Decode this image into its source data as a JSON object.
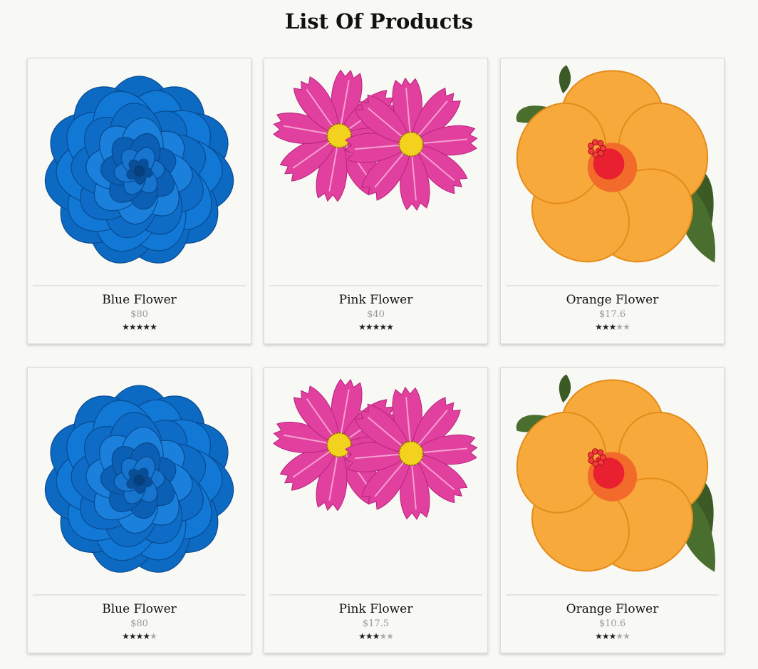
{
  "page": {
    "title": "List Of Products"
  },
  "colors": {
    "blue": "#1176d4",
    "pink": "#e2409f",
    "orange": "#f7a93b",
    "leaf": "#4a6e2e"
  },
  "products": [
    {
      "name": "Blue Flower",
      "price": "$80",
      "rating": 5,
      "max_rating": 5,
      "image": "blue-rose-icon"
    },
    {
      "name": "Pink Flower",
      "price": "$40",
      "rating": 5,
      "max_rating": 5,
      "image": "pink-cosmos-icon"
    },
    {
      "name": "Orange Flower",
      "price": "$17.6",
      "rating": 3,
      "max_rating": 5,
      "image": "orange-hibiscus-icon"
    },
    {
      "name": "Blue Flower",
      "price": "$80",
      "rating": 4,
      "max_rating": 5,
      "image": "blue-rose-icon"
    },
    {
      "name": "Pink Flower",
      "price": "$17.5",
      "rating": 3,
      "max_rating": 5,
      "image": "pink-cosmos-icon"
    },
    {
      "name": "Orange Flower",
      "price": "$10.6",
      "rating": 3,
      "max_rating": 5,
      "image": "orange-hibiscus-icon"
    }
  ]
}
